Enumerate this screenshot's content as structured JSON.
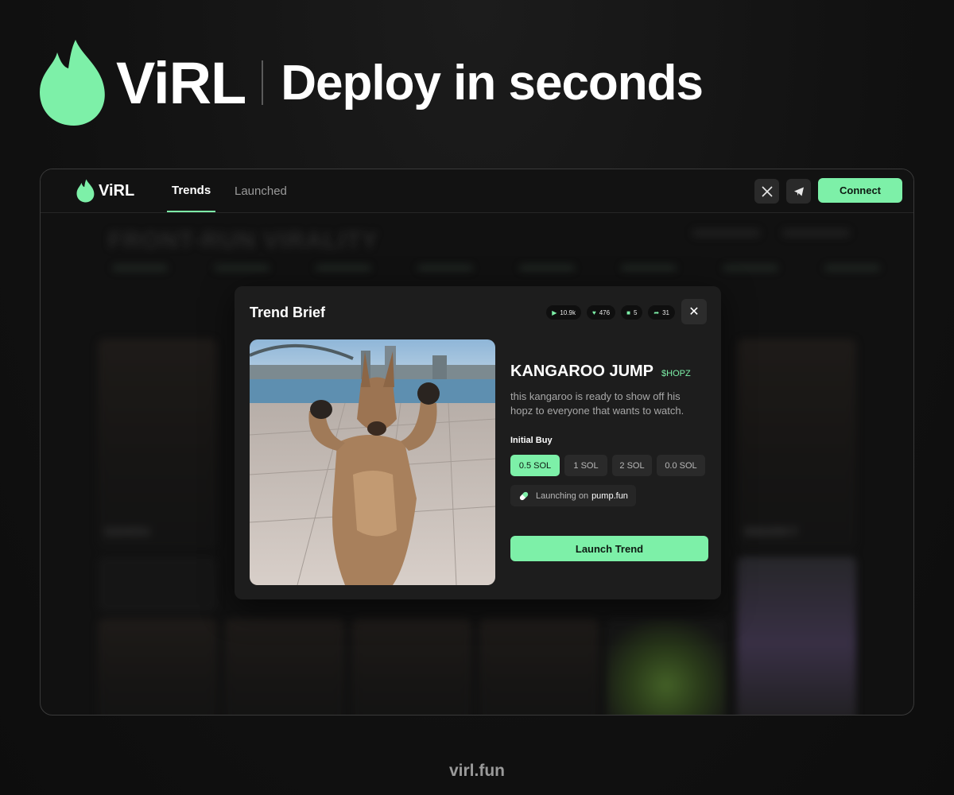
{
  "hero": {
    "brand": "ViRL",
    "tagline": "Deploy in seconds",
    "logo_icon": "flame-icon"
  },
  "colors": {
    "accent": "#7df0a8",
    "background": "#111111",
    "panel": "#1d1d1d"
  },
  "nav": {
    "brand": "ViRL",
    "tabs": [
      {
        "label": "Trends",
        "active": true
      },
      {
        "label": "Launched",
        "active": false
      }
    ],
    "icons": [
      "x-icon",
      "telegram-icon"
    ],
    "connect_label": "Connect"
  },
  "background_page": {
    "heading": "FRONT-RUN VIRALITY",
    "card_labels": [
      "SAHOU",
      "SMARKY"
    ]
  },
  "modal": {
    "title": "Trend Brief",
    "stats": [
      {
        "icon": "play-icon",
        "value": "10.9k"
      },
      {
        "icon": "heart-icon",
        "value": "476"
      },
      {
        "icon": "comment-icon",
        "value": "5"
      },
      {
        "icon": "share-icon",
        "value": "31"
      }
    ],
    "close_icon": "close-icon",
    "trend_name": "KANGAROO JUMP",
    "ticker": "$HOPZ",
    "description": "this kangaroo is ready to show off his hopz to everyone that wants to watch.",
    "initial_buy_label": "Initial Buy",
    "buy_options": [
      {
        "label": "0.5 SOL",
        "selected": true
      },
      {
        "label": "1 SOL",
        "selected": false
      },
      {
        "label": "2 SOL",
        "selected": false
      },
      {
        "label": "0.0 SOL",
        "selected": false
      }
    ],
    "launching_prefix": "Launching on",
    "launching_platform": "pump.fun",
    "launch_button": "Launch Trend"
  },
  "footer": {
    "url": "virl.fun"
  }
}
